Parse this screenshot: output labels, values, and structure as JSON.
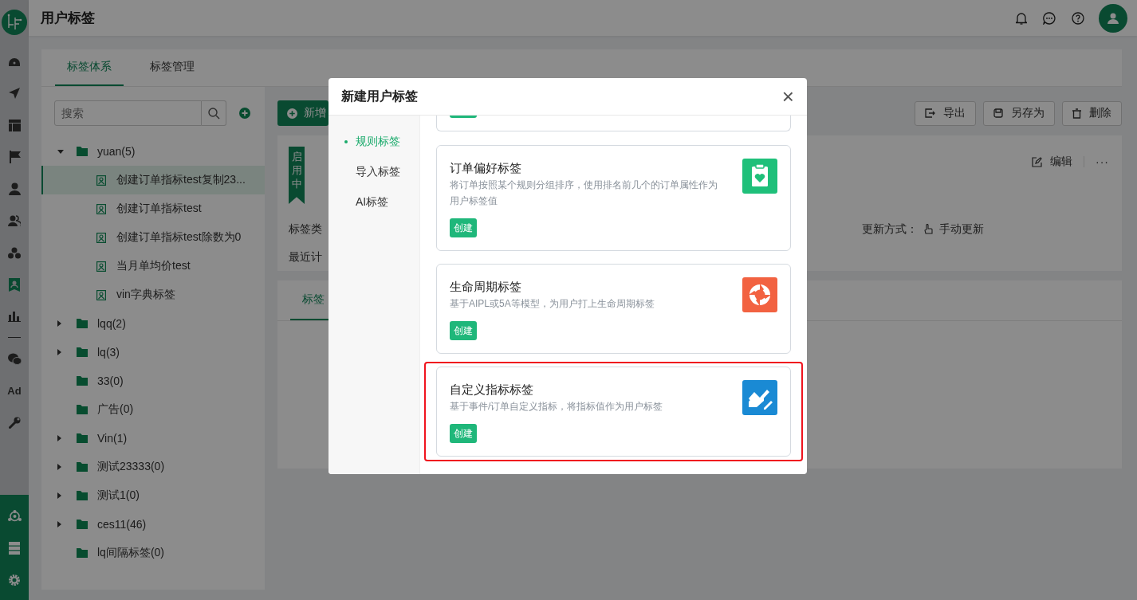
{
  "header": {
    "title": "用户标签"
  },
  "rail": {
    "items": [
      {
        "kind": "dashboard",
        "selected": false
      },
      {
        "kind": "send",
        "selected": false
      },
      {
        "kind": "layout",
        "selected": false
      },
      {
        "kind": "flag",
        "selected": false
      },
      {
        "kind": "user",
        "selected": false
      },
      {
        "kind": "users",
        "selected": false
      },
      {
        "kind": "cluster",
        "selected": false
      },
      {
        "kind": "tag",
        "selected": true
      },
      {
        "kind": "chart",
        "selected": false
      }
    ],
    "items_2": [
      {
        "kind": "wechat",
        "selected": false
      },
      {
        "kind": "text",
        "label": "Ad",
        "selected": false
      },
      {
        "kind": "wrench",
        "selected": false
      }
    ],
    "bottom_items": [
      {
        "kind": "network"
      },
      {
        "kind": "server"
      },
      {
        "kind": "gear"
      }
    ]
  },
  "tabs": [
    {
      "label": "标签体系",
      "selected": true
    },
    {
      "label": "标签管理",
      "selected": false
    }
  ],
  "search": {
    "placeholder": "搜索"
  },
  "tree": [
    {
      "label": "yuan(5)",
      "expanded": true,
      "children": [
        {
          "label": "创建订单指标test复制23...",
          "selected": true
        },
        {
          "label": "创建订单指标test",
          "selected": false
        },
        {
          "label": "创建订单指标test除数为0",
          "selected": false
        },
        {
          "label": "当月单均价test",
          "selected": false
        },
        {
          "label": "vin字典标签",
          "selected": false
        }
      ]
    },
    {
      "label": "lqq(2)",
      "expanded": false
    },
    {
      "label": "lq(3)",
      "expanded": false
    },
    {
      "label": "33(0)"
    },
    {
      "label": "广告(0)"
    },
    {
      "label": "Vin(1)",
      "expanded": false
    },
    {
      "label": "测试23333(0)",
      "expanded": false
    },
    {
      "label": "测试1(0)",
      "expanded": false
    },
    {
      "label": "ces11(46)",
      "expanded": false
    },
    {
      "label": "lq间隔标签(0)"
    }
  ],
  "toolbar": {
    "new_button": "新增",
    "actions": [
      "导出",
      "另存为",
      "删除"
    ]
  },
  "detail": {
    "status": "启用中",
    "edit": "编辑",
    "more": "···",
    "field_1": "标签类",
    "update_label": "更新方式：",
    "update_value": "手动更新",
    "field_2": "最近计",
    "tab": "标签"
  },
  "dialog": {
    "title": "新建用户标签",
    "close": "×",
    "nav": [
      {
        "label": "规则标签",
        "selected": true
      },
      {
        "label": "导入标签",
        "selected": false
      },
      {
        "label": "AI标签",
        "selected": false
      }
    ],
    "cards": [
      {
        "kind": "preference",
        "title": "订单偏好标签",
        "description": "将订单按照某个规则分组排序，使用排名前几个的订单属性作为用户标签值",
        "button": "创建",
        "highlighted": false
      },
      {
        "kind": "lifecycle",
        "title": "生命周期标签",
        "description": "基于AIPL或5A等模型，为用户打上生命周期标签",
        "button": "创建",
        "highlighted": false
      },
      {
        "kind": "metric",
        "title": "自定义指标标签",
        "description": "基于事件/订单自定义指标，将指标值作为用户标签",
        "button": "创建",
        "highlighted": true
      }
    ]
  }
}
